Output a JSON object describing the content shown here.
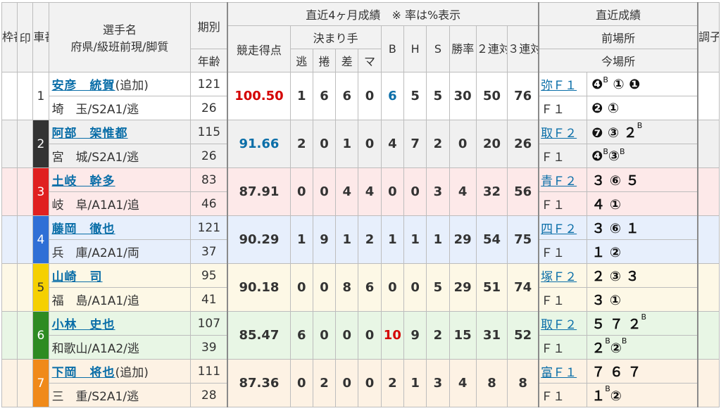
{
  "headers": {
    "waku": "枠番",
    "mark": "印",
    "shaban": "車番",
    "name_top": "選手名",
    "name_bottom": "府県/級班前現/脚質",
    "kibetsu": "期別",
    "age": "年齢",
    "recent4": "直近4ヶ月成績　※ 率は%表示",
    "score": "競走得点",
    "kimarite": "決まり手",
    "nige": "逃",
    "makuri": "捲",
    "sashi": "差",
    "ma": "マ",
    "b": "B",
    "h": "H",
    "s": "S",
    "win": "勝率",
    "quin": "２連対率",
    "trio": "３連対率",
    "recent": "直近成績",
    "prev_venue": "前場所",
    "cur_venue": "今場所",
    "condition": "調子"
  },
  "riders": [
    {
      "num": "1",
      "name": "安彦　統賀",
      "extra": "(追加)",
      "info": "埼　玉/S2A1/逃",
      "kibetsu": "121",
      "age": "26",
      "score": "100.50",
      "nige": "1",
      "makuri": "6",
      "sashi": "6",
      "ma": "0",
      "b": "6",
      "h": "5",
      "s": "5",
      "win": "30",
      "quin": "50",
      "trio": "76",
      "prev": "弥Ｆ１",
      "prev_res": "❹ᴮ ① ❶",
      "cur": "Ｆ１",
      "cur_res": "❷ ①"
    },
    {
      "num": "2",
      "name": "阿部　架惟都",
      "extra": "",
      "info": "宮　城/S2A1/逃",
      "kibetsu": "115",
      "age": "26",
      "score": "91.66",
      "nige": "2",
      "makuri": "0",
      "sashi": "1",
      "ma": "0",
      "b": "4",
      "h": "7",
      "s": "2",
      "win": "0",
      "quin": "20",
      "trio": "26",
      "prev": "取Ｆ２",
      "prev_res": "❼ ③ ２ᴮ",
      "cur": "Ｆ１",
      "cur_res": "❹ᴮ③ᴮ"
    },
    {
      "num": "3",
      "name": "土岐　幹多",
      "extra": "",
      "info": "岐　阜/A1A1/追",
      "kibetsu": "83",
      "age": "46",
      "score": "87.91",
      "nige": "0",
      "makuri": "0",
      "sashi": "4",
      "ma": "4",
      "b": "0",
      "h": "0",
      "s": "3",
      "win": "4",
      "quin": "32",
      "trio": "56",
      "prev": "青Ｆ２",
      "prev_res": "３ ⑥ ５",
      "cur": "Ｆ１",
      "cur_res": "４ ①"
    },
    {
      "num": "4",
      "name": "藤岡　徹也",
      "extra": "",
      "info": "兵　庫/A2A1/両",
      "kibetsu": "121",
      "age": "37",
      "score": "90.29",
      "nige": "1",
      "makuri": "9",
      "sashi": "1",
      "ma": "2",
      "b": "1",
      "h": "1",
      "s": "1",
      "win": "29",
      "quin": "54",
      "trio": "75",
      "prev": "四Ｆ２",
      "prev_res": "３ ⑥ １",
      "cur": "Ｆ１",
      "cur_res": "１ ②"
    },
    {
      "num": "5",
      "name": "山崎　司",
      "extra": "",
      "info": "福　島/A1A1/追",
      "kibetsu": "95",
      "age": "41",
      "score": "90.18",
      "nige": "0",
      "makuri": "0",
      "sashi": "8",
      "ma": "6",
      "b": "0",
      "h": "0",
      "s": "5",
      "win": "29",
      "quin": "51",
      "trio": "74",
      "prev": "塚Ｆ２",
      "prev_res": "２ ③ ３",
      "cur": "Ｆ１",
      "cur_res": "３ ①"
    },
    {
      "num": "6",
      "name": "小林　史也",
      "extra": "",
      "info": "和歌山/A1A2/逃",
      "kibetsu": "107",
      "age": "39",
      "score": "85.47",
      "nige": "6",
      "makuri": "0",
      "sashi": "0",
      "ma": "0",
      "b": "10",
      "h": "9",
      "s": "2",
      "win": "15",
      "quin": "31",
      "trio": "52",
      "prev": "取Ｆ２",
      "prev_res": "５ ７ ２ᴮ",
      "cur": "Ｆ１",
      "cur_res": "２ᴮ②ᴮ"
    },
    {
      "num": "7",
      "name": "下岡　将也",
      "extra": "(追加)",
      "info": "三　重/S2A1/逃",
      "kibetsu": "111",
      "age": "28",
      "score": "87.36",
      "nige": "0",
      "makuri": "2",
      "sashi": "0",
      "ma": "0",
      "b": "2",
      "h": "1",
      "s": "3",
      "win": "4",
      "quin": "8",
      "trio": "8",
      "prev": "富Ｆ１",
      "prev_res": "７ ６ ７",
      "cur": "Ｆ１",
      "cur_res": "１ᴮ②"
    }
  ],
  "colors": {
    "score_top": "#d40000",
    "score_second": "#0a6ea8",
    "b_top": "#d40000",
    "b_second": "#0a6ea8"
  }
}
